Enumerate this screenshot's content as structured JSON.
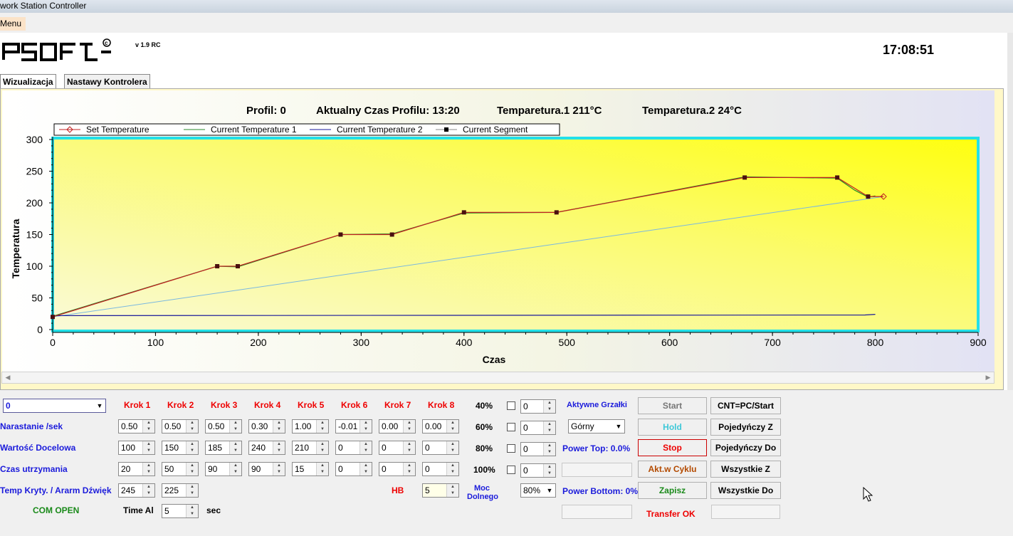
{
  "window": {
    "title": "work Station Controller"
  },
  "menu": {
    "label": "Menu"
  },
  "header": {
    "logo_text": "PSOFT",
    "version": "v 1.9 RC",
    "clock": "17:08:51"
  },
  "tabs": [
    {
      "label": "Wizualizacja"
    },
    {
      "label": "Nastawy Kontrolera"
    }
  ],
  "status": {
    "profil_label": "Profil:",
    "profil_value": "0",
    "czas_label": "Aktualny Czas Profilu:",
    "czas_value": "13:20",
    "temp1_label": "Temparetura.1",
    "temp1_value": "211°C",
    "temp2_label": "Temparetura.2",
    "temp2_value": "24°C"
  },
  "chart_data": {
    "type": "line",
    "xlabel": "Czas",
    "ylabel": "Temperatura",
    "xlim": [
      0,
      900
    ],
    "ylim": [
      0,
      300
    ],
    "x_ticks": [
      0,
      100,
      200,
      300,
      400,
      500,
      600,
      700,
      800,
      900
    ],
    "y_ticks": [
      0,
      50,
      100,
      150,
      200,
      250,
      300
    ],
    "legend_position": "top-left",
    "series": [
      {
        "name": "Set Temperature",
        "color": "#c02020",
        "marker": "diamond",
        "x": [
          0,
          160,
          180,
          280,
          330,
          400,
          490,
          673,
          763,
          793,
          808
        ],
        "y": [
          20,
          100,
          100,
          150,
          150,
          185,
          185,
          240,
          240,
          210,
          210
        ]
      },
      {
        "name": "Current Temperature 1",
        "color": "#2a8a2a",
        "marker": "none",
        "x": [
          0,
          160,
          180,
          280,
          330,
          400,
          490,
          673,
          763,
          780,
          793,
          800
        ],
        "y": [
          21,
          100,
          99,
          150,
          151,
          184,
          185,
          241,
          239,
          220,
          209,
          211
        ]
      },
      {
        "name": "Current Temperature 2",
        "color": "#1a1a9a",
        "marker": "none",
        "x": [
          0,
          790,
          800
        ],
        "y": [
          22,
          23,
          24
        ]
      },
      {
        "name": "Current Segment",
        "color": "#4a1010",
        "marker": "square",
        "x": [
          0,
          160,
          180,
          280,
          330,
          400,
          490,
          673,
          763,
          793
        ],
        "y": [
          20,
          100,
          100,
          150,
          150,
          185,
          185,
          240,
          240,
          210
        ]
      },
      {
        "name": "",
        "color": "#7ab8e0",
        "marker": "none",
        "x": [
          0,
          808
        ],
        "y": [
          20,
          210
        ]
      }
    ]
  },
  "controls": {
    "profile_select": "0",
    "steps": [
      "Krok 1",
      "Krok 2",
      "Krok 3",
      "Krok 4",
      "Krok 5",
      "Krok 6",
      "Krok 7",
      "Krok 8"
    ],
    "rows": [
      {
        "label": "Narastanie /sek",
        "values": [
          "0.50",
          "0.50",
          "0.50",
          "0.30",
          "1.00",
          "-0.01",
          "0.00",
          "0.00"
        ]
      },
      {
        "label": "Wartość Docelowa",
        "values": [
          "100",
          "150",
          "185",
          "240",
          "210",
          "0",
          "0",
          "0"
        ]
      },
      {
        "label": "Czas utrzymania",
        "values": [
          "20",
          "50",
          "90",
          "90",
          "15",
          "0",
          "0",
          "0"
        ]
      }
    ],
    "temp_kryt_label": "Temp Kryty. / Ararm Dźwięk",
    "temp_kryt_values": [
      "245",
      "225"
    ],
    "com_status": "COM OPEN",
    "time_al_label": "Time Al",
    "time_al_value": "5",
    "time_al_unit": "sec",
    "hb_label": "HB",
    "hb_value": "5",
    "moc_label_1": "Moc",
    "moc_label_2": "Dolnego",
    "moc_value": "80%",
    "percent_rows": [
      {
        "pct": "40%",
        "value": "0"
      },
      {
        "pct": "60%",
        "value": "0"
      },
      {
        "pct": "80%",
        "value": "0"
      },
      {
        "pct": "100%",
        "value": "0"
      }
    ],
    "aktywne_label": "Aktywne Grzałki",
    "grzalki_value": "Górny",
    "power_top": "Power Top:  0.0%",
    "power_bottom": "Power Bottom: 0%",
    "buttons": {
      "start": "Start",
      "hold": "Hold",
      "stop": "Stop",
      "akt_cyklu": "Akt.w Cyklu",
      "zapisz": "Zapisz",
      "cnt": "CNT=PC/Start",
      "poj_z": "Pojedyńczy Z",
      "poj_do": "Pojedyńczy Do",
      "wszystkie_z": "Wszystkie Z",
      "wszystkie_do": "Wszystkie Do"
    },
    "transfer_status": "Transfer OK"
  }
}
